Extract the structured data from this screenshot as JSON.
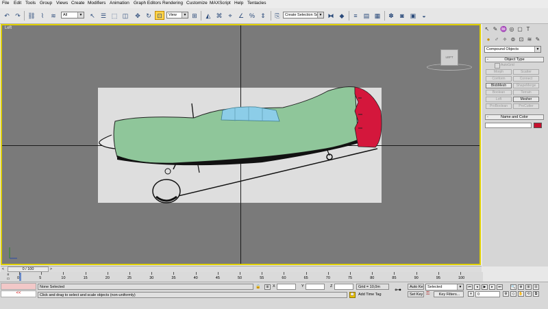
{
  "menu": [
    "File",
    "Edit",
    "Tools",
    "Group",
    "Views",
    "Create",
    "Modifiers",
    "Animation",
    "Graph Editors",
    "Rendering",
    "Customize",
    "MAXScript",
    "Help",
    "Tentacles"
  ],
  "toolbar": {
    "filter_value": "All",
    "refcoord_value": "View",
    "named_selection_placeholder": "Create Selection Set",
    "icons": [
      "undo-icon",
      "redo-icon",
      "link-icon",
      "unlink-icon",
      "bind-space-warp-icon",
      "select-object-icon",
      "select-by-name-icon",
      "rectangular-selection-icon",
      "select-move-icon",
      "select-rotate-icon",
      "select-scale-icon",
      "pivot-icon",
      "manipulate-icon",
      "snap-icon",
      "angle-snap-icon",
      "percent-snap-icon",
      "spinner-snap-icon",
      "named-selection-icon",
      "mirror-icon",
      "align-icon",
      "layer-icon",
      "curve-editor-icon",
      "schematic-icon",
      "material-editor-icon",
      "render-setup-icon",
      "render-icon"
    ]
  },
  "viewport": {
    "label": "Left",
    "viewcube_label": "LEFT",
    "active_border_color": "#e0d000",
    "plane_colors": {
      "body": "#8fc69a",
      "tail": "#d4173c",
      "canopy": "#8ccde8"
    }
  },
  "command_panel": {
    "tabs": [
      "create-tab-icon",
      "modify-tab-icon",
      "hierarchy-tab-icon",
      "motion-tab-icon",
      "display-tab-icon",
      "utilities-tab-icon"
    ],
    "category_value": "Compound Objects",
    "object_type_header": "Object Type",
    "autogrid_label": "AutoGrid",
    "buttons": [
      {
        "label": "Morph",
        "enabled": false
      },
      {
        "label": "Scatter",
        "enabled": false
      },
      {
        "label": "Conform",
        "enabled": false
      },
      {
        "label": "Connect",
        "enabled": false
      },
      {
        "label": "BlobMesh",
        "enabled": true
      },
      {
        "label": "ShapeMerge",
        "enabled": false
      },
      {
        "label": "Boolean",
        "enabled": false
      },
      {
        "label": "Terrain",
        "enabled": false
      },
      {
        "label": "Loft",
        "enabled": false
      },
      {
        "label": "Mesher",
        "enabled": true
      },
      {
        "label": "ProBoolean",
        "enabled": false
      },
      {
        "label": "ProCutter",
        "enabled": false
      }
    ],
    "name_color_header": "Name and Color",
    "swatch_color": "#c8102e"
  },
  "timeslider": {
    "label": "0 / 100"
  },
  "trackbar": {
    "ticks": [
      "0",
      "5",
      "10",
      "15",
      "20",
      "25",
      "30",
      "35",
      "40",
      "45",
      "50",
      "55",
      "60",
      "65",
      "70",
      "75",
      "80",
      "85",
      "90",
      "95",
      "100"
    ]
  },
  "status": {
    "selection": "None Selected",
    "prompt": "Click and drag to select and scale objects (non-uniformly)",
    "x_label": "X",
    "y_label": "Y",
    "z_label": "Z",
    "grid": "Grid = 10,0m",
    "add_time_tag": "Add Time Tag",
    "auto_key": "Auto Key",
    "set_key": "Set Key",
    "key_mode_value": "Selected",
    "key_filters": "Key Filters...",
    "frame_value": "0",
    "maxscript_btn": "<<"
  }
}
